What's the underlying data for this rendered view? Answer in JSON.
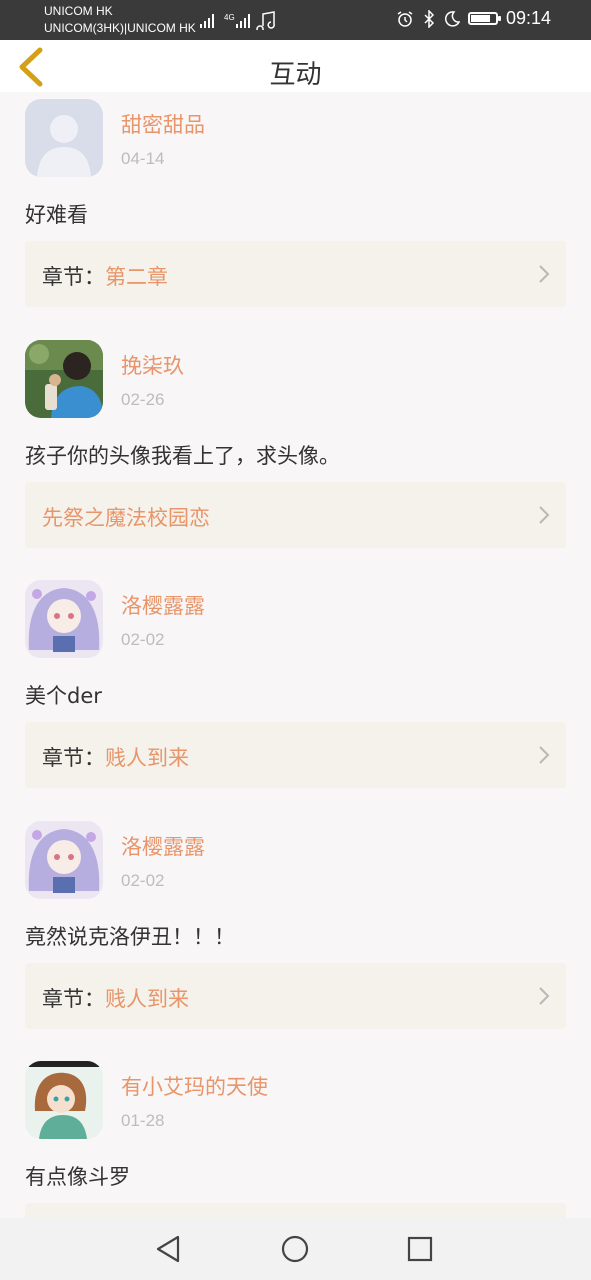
{
  "status_bar": {
    "carrier_line1": "UNICOM HK",
    "carrier_line2": "UNICOM(3HK)|UNICOM HK",
    "time": "09:14"
  },
  "header": {
    "title": "互动"
  },
  "feed": [
    {
      "user": "甜密甜品",
      "date": "04-14",
      "text": "好难看",
      "chapter_prefix": "章节：",
      "chapter_name": "第二章",
      "avatar": "default-avatar"
    },
    {
      "user": "挽柒玖",
      "date": "02-26",
      "text": "孩子你的头像我看上了，求头像。",
      "chapter_prefix": "",
      "chapter_name": "先祭之魔法校园恋",
      "avatar": "photo-avatar"
    },
    {
      "user": "洛樱露露",
      "date": "02-02",
      "text": "美个der",
      "chapter_prefix": "章节：",
      "chapter_name": "贱人到来",
      "avatar": "anime-girl-avatar"
    },
    {
      "user": "洛樱露露",
      "date": "02-02",
      "text": "竟然说克洛伊丑！！！",
      "chapter_prefix": "章节：",
      "chapter_name": "贱人到来",
      "avatar": "anime-girl-avatar"
    },
    {
      "user": "有小艾玛的天使",
      "date": "01-28",
      "text": "有点像斗罗",
      "chapter_prefix": "",
      "chapter_name": "",
      "avatar": "anime-boy-avatar"
    }
  ],
  "nav_bar": {
    "back_icon": "triangle-back-icon",
    "home_icon": "circle-home-icon",
    "recents_icon": "square-recents-icon"
  },
  "colors": {
    "accent": "#e8956a",
    "chapter_bg": "#f4f2ea",
    "page_bg": "#f8f6f7",
    "back_arrow": "#d4a017"
  }
}
